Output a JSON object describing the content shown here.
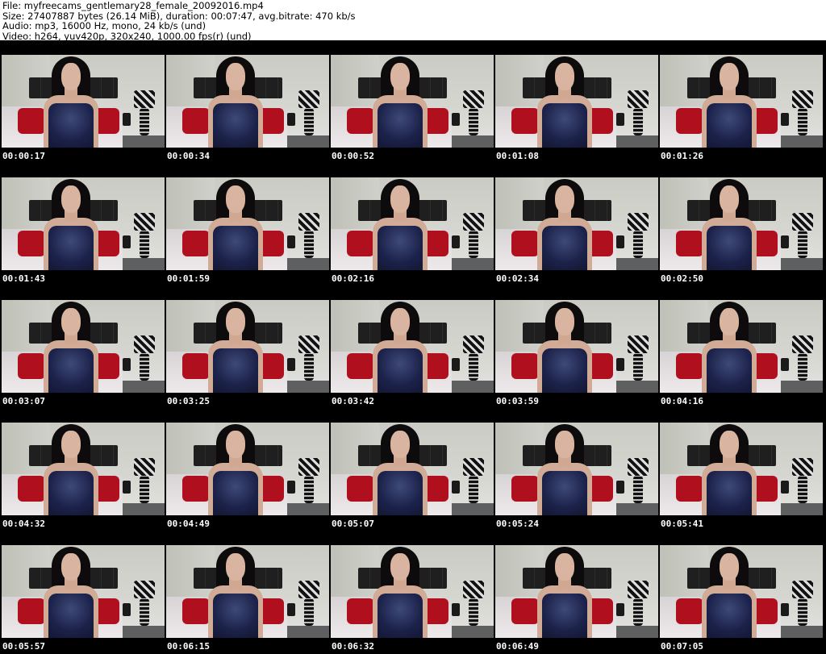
{
  "header": {
    "file_line": "File: myfreecams_gentlemary28_female_20092016.mp4",
    "size_line": "Size: 27407887 bytes (26.14 MiB), duration: 00:07:47, avg.bitrate: 470 kb/s",
    "audio_line": "Audio: mp3, 16000 Hz, mono, 24 kb/s (und)",
    "video_line": "Video: h264, yuv420p, 320x240, 1000.00 fps(r) (und)"
  },
  "thumbnails": [
    {
      "timestamp": "00:00:17"
    },
    {
      "timestamp": "00:00:34"
    },
    {
      "timestamp": "00:00:52"
    },
    {
      "timestamp": "00:01:08"
    },
    {
      "timestamp": "00:01:26"
    },
    {
      "timestamp": "00:01:43"
    },
    {
      "timestamp": "00:01:59"
    },
    {
      "timestamp": "00:02:16"
    },
    {
      "timestamp": "00:02:34"
    },
    {
      "timestamp": "00:02:50"
    },
    {
      "timestamp": "00:03:07"
    },
    {
      "timestamp": "00:03:25"
    },
    {
      "timestamp": "00:03:42"
    },
    {
      "timestamp": "00:03:59"
    },
    {
      "timestamp": "00:04:16"
    },
    {
      "timestamp": "00:04:32"
    },
    {
      "timestamp": "00:04:49"
    },
    {
      "timestamp": "00:05:07"
    },
    {
      "timestamp": "00:05:24"
    },
    {
      "timestamp": "00:05:41"
    },
    {
      "timestamp": "00:05:57"
    },
    {
      "timestamp": "00:06:15"
    },
    {
      "timestamp": "00:06:32"
    },
    {
      "timestamp": "00:06:49"
    },
    {
      "timestamp": "00:07:05"
    }
  ]
}
